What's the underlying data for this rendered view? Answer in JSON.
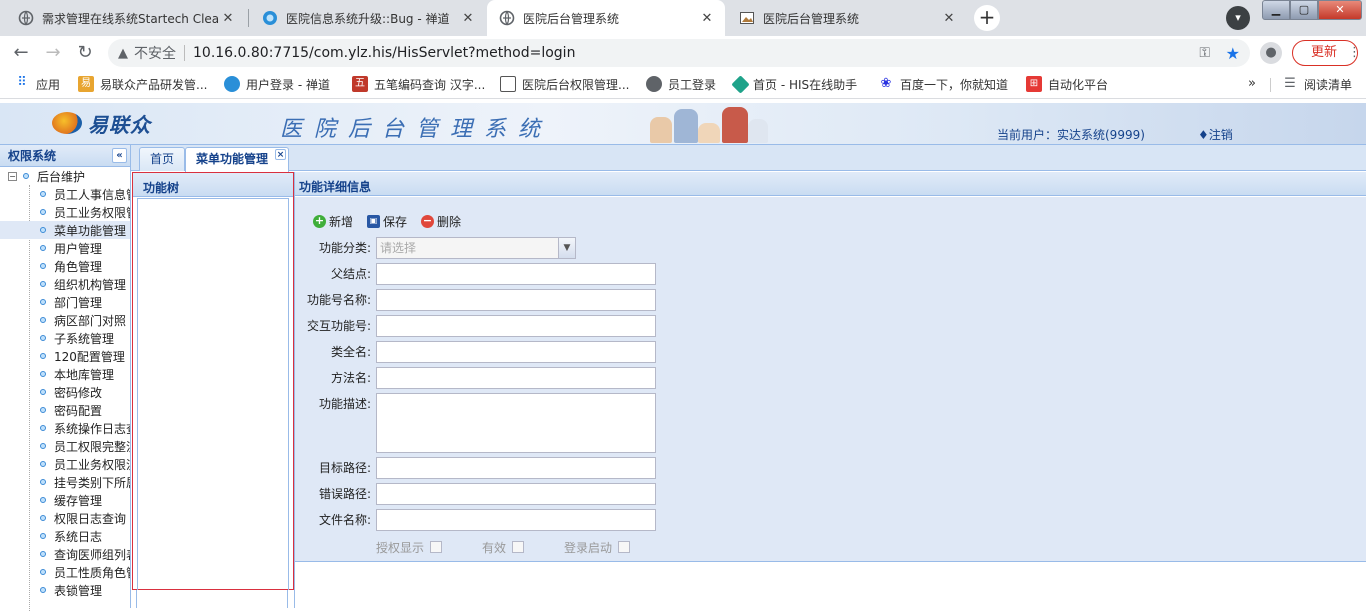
{
  "browser": {
    "tabs": [
      {
        "title": "需求管理在线系统Startech Clea",
        "favicon": "globe-icon"
      },
      {
        "title": "医院信息系统升级::Bug - 禅道",
        "favicon": "zentao-icon"
      },
      {
        "title": "医院后台管理系统",
        "favicon": "globe-icon",
        "active": true
      },
      {
        "title": "医院后台管理系统",
        "favicon": "picture-icon"
      }
    ],
    "new_tab": "+",
    "address": {
      "security_label": "不安全",
      "url": "10.16.0.80:7715/com.ylz.his/HisServlet?method=login"
    },
    "update_label": "更新",
    "bookmarks": [
      {
        "label": "应用",
        "icon": "apps-grid-icon"
      },
      {
        "label": "易联众产品研发管...",
        "icon": "ylz-icon"
      },
      {
        "label": "用户登录 - 禅道",
        "icon": "zentao-icon"
      },
      {
        "label": "五笔编码查询 汉字...",
        "icon": "wubi-icon"
      },
      {
        "label": "医院后台权限管理...",
        "icon": "picture-icon"
      },
      {
        "label": "员工登录",
        "icon": "globe-icon"
      },
      {
        "label": "首页 - HIS在线助手",
        "icon": "his-icon"
      },
      {
        "label": "百度一下，你就知道",
        "icon": "baidu-icon"
      },
      {
        "label": "自动化平台",
        "icon": "platform-icon"
      }
    ],
    "more": "»",
    "reading_list": "阅读清单"
  },
  "header": {
    "brand": "易联众",
    "system_title": "医院后台管理系统",
    "current_user": "当前用户：实达系统(9999)",
    "logout": "♦注销"
  },
  "nav": {
    "title": "权限系统",
    "collapse": "«",
    "root": {
      "label": "后台维护",
      "expander": "−"
    },
    "items": [
      {
        "label": "员工人事信息管"
      },
      {
        "label": "员工业务权限管"
      },
      {
        "label": "菜单功能管理",
        "selected": true
      },
      {
        "label": "用户管理"
      },
      {
        "label": "角色管理"
      },
      {
        "label": "组织机构管理"
      },
      {
        "label": "部门管理"
      },
      {
        "label": "病区部门对照"
      },
      {
        "label": "子系统管理"
      },
      {
        "label": "120配置管理"
      },
      {
        "label": "本地库管理"
      },
      {
        "label": "密码修改"
      },
      {
        "label": "密码配置"
      },
      {
        "label": "系统操作日志查"
      },
      {
        "label": "员工权限完整流"
      },
      {
        "label": "员工业务权限流"
      },
      {
        "label": "挂号类别下所属"
      },
      {
        "label": "缓存管理"
      },
      {
        "label": "权限日志查询"
      },
      {
        "label": "系统日志"
      },
      {
        "label": "查询医师组列表"
      },
      {
        "label": "员工性质角色管"
      },
      {
        "label": "表锁管理"
      }
    ]
  },
  "content_tabs": [
    {
      "label": "首页"
    },
    {
      "label": "菜单功能管理",
      "active": true,
      "close": "×"
    }
  ],
  "function_tree": {
    "title": "功能树"
  },
  "detail": {
    "title": "功能详细信息",
    "toolbar": {
      "add": "新增",
      "save": "保存",
      "delete": "删除"
    },
    "fields": {
      "category": {
        "label": "功能分类:",
        "placeholder": "请选择"
      },
      "parent": {
        "label": "父结点:",
        "value": ""
      },
      "func_name": {
        "label": "功能号名称:",
        "value": ""
      },
      "interact_no": {
        "label": "交互功能号:",
        "value": ""
      },
      "class_name": {
        "label": "类全名:",
        "value": ""
      },
      "method_name": {
        "label": "方法名:",
        "value": ""
      },
      "description": {
        "label": "功能描述:",
        "value": ""
      },
      "target_path": {
        "label": "目标路径:",
        "value": ""
      },
      "error_path": {
        "label": "错误路径:",
        "value": ""
      },
      "file_name": {
        "label": "文件名称:",
        "value": ""
      }
    },
    "checkboxes": {
      "authorize_display": "授权显示",
      "valid": "有效",
      "login_start": "登录启动"
    }
  },
  "colors": {
    "accent": "#15428b",
    "panel_border": "#99bbe8",
    "highlight_border": "#d9303f",
    "form_bg": "#dfe8f6"
  }
}
